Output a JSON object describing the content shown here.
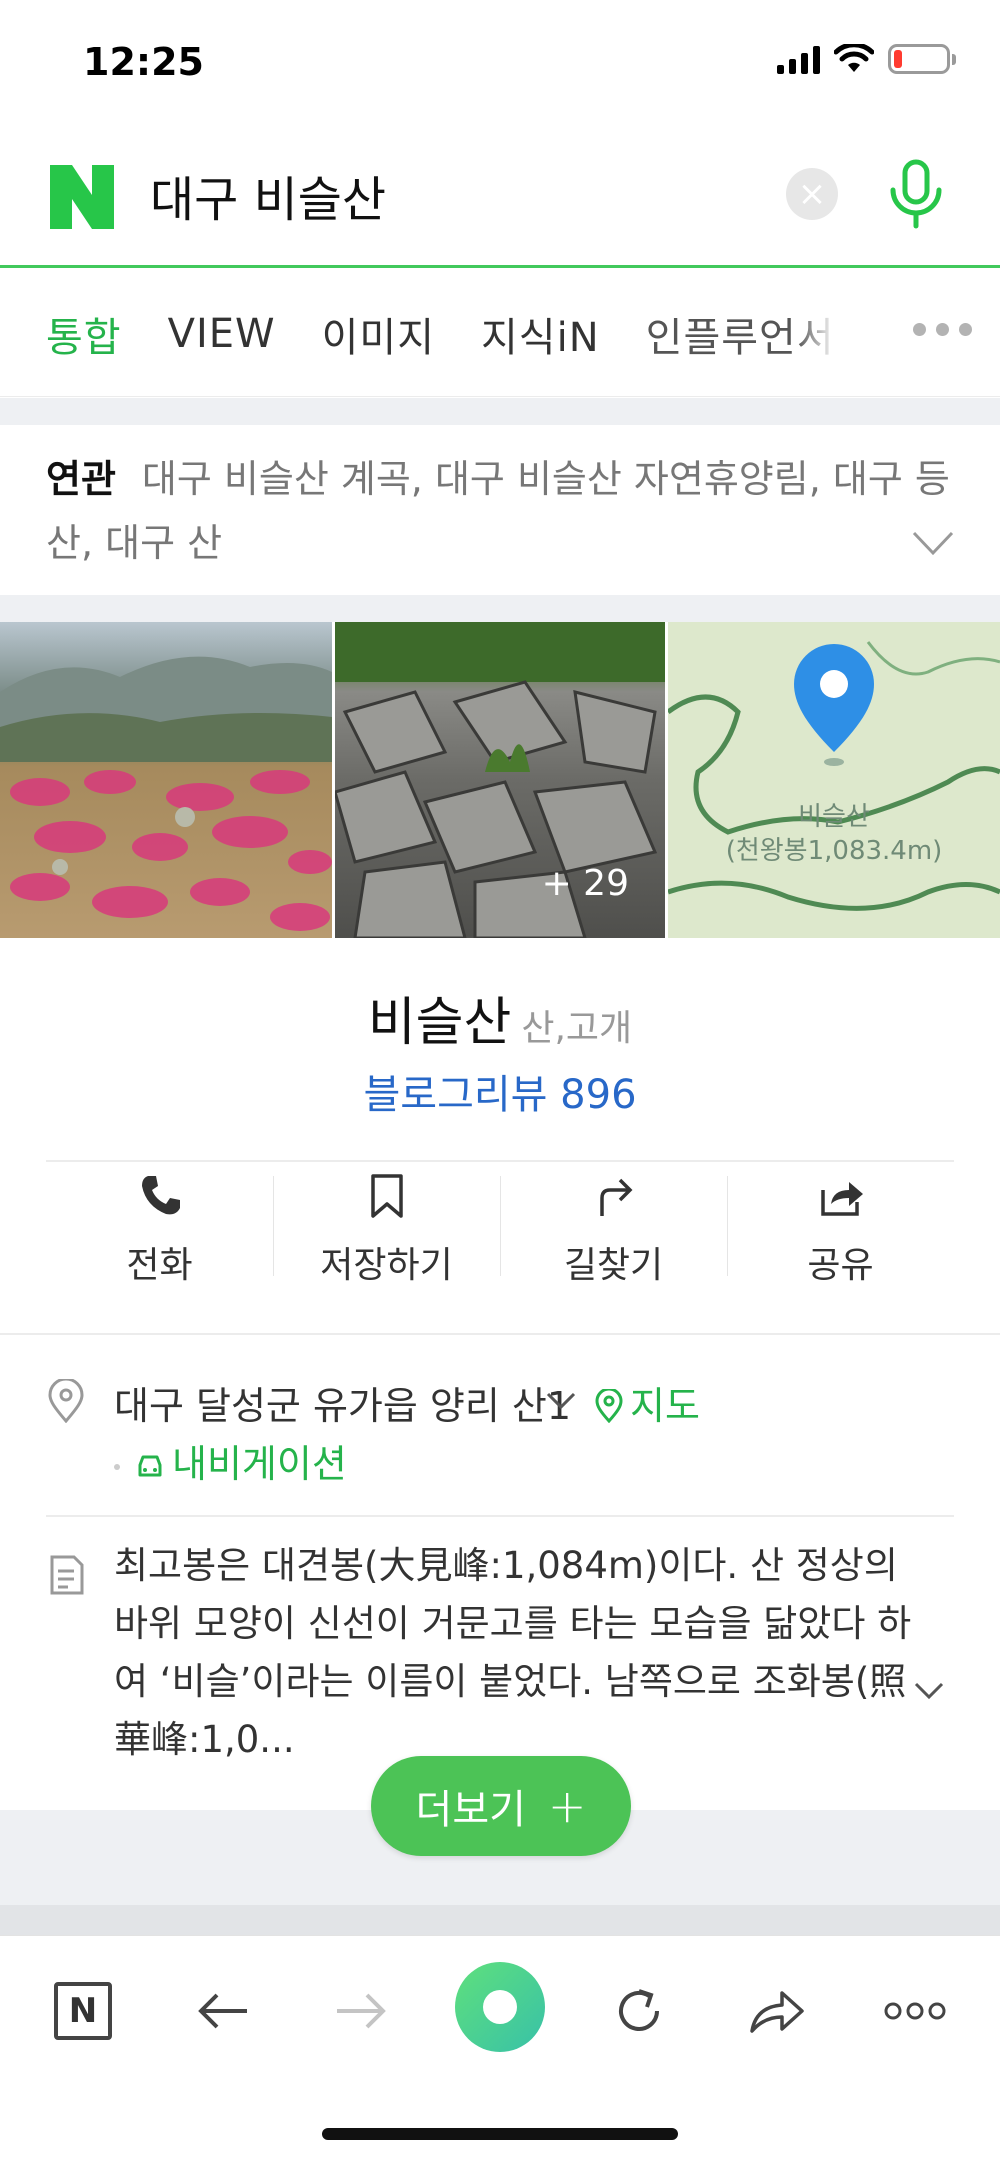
{
  "status_bar": {
    "time": "12:25"
  },
  "search": {
    "query": "대구 비슬산",
    "clear_symbol": "×"
  },
  "tabs": [
    {
      "label": "통합",
      "active": true
    },
    {
      "label": "VIEW"
    },
    {
      "label": "이미지"
    },
    {
      "label": "지식iN"
    },
    {
      "label": "인플루언서"
    }
  ],
  "related": {
    "label": "연관",
    "text": "대구 비슬산 계곡, 대구 비슬산 자연휴양림, 대구 등산, 대구 산"
  },
  "photos": {
    "more_count": "+ 29",
    "map_label_1": "비슬산",
    "map_label_2": "(천왕봉1,083.4m)"
  },
  "place": {
    "name": "비슬산",
    "category": "산,고개",
    "blog_review": "블로그리뷰 896",
    "actions": [
      {
        "label": "전화",
        "icon": "phone-icon"
      },
      {
        "label": "저장하기",
        "icon": "bookmark-icon"
      },
      {
        "label": "길찾기",
        "icon": "directions-icon"
      },
      {
        "label": "공유",
        "icon": "share-icon"
      }
    ]
  },
  "details": {
    "address": "대구 달성군 유가읍 양리 산1",
    "map_link": "지도",
    "navigation_link": "내비게이션",
    "description": "최고봉은 대견봉(大見峰:1,084m)이다.  산 정상의 바위 모양이 신선이 거문고를 타는 모습을 닮았다 하여 ‘비슬’이라는 이름이 붙었다. 남쪽으로 조화봉(照華峰:1,0..."
  },
  "more_button": {
    "label": "더보기",
    "plus": "+"
  },
  "toolbar": {
    "home_letter": "N"
  },
  "colors": {
    "accent_green": "#25b34b",
    "link_blue": "#2868c8",
    "button_green": "#4cc356"
  }
}
